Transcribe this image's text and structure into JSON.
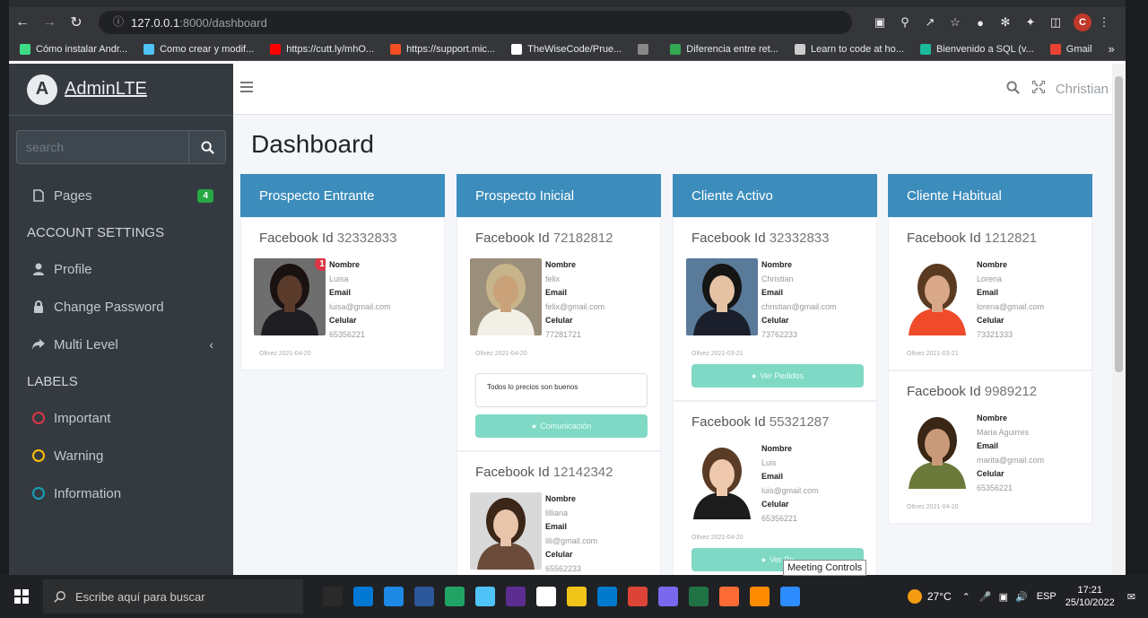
{
  "browser": {
    "url_host": "127.0.0.1",
    "url_path": ":8000/dashboard",
    "profile_initial": "C",
    "bookmarks": [
      {
        "label": "Cómo instalar Andr...",
        "color": "#3ddc84"
      },
      {
        "label": "Como crear y modif...",
        "color": "#4fc3f7"
      },
      {
        "label": "https://cutt.ly/mhO...",
        "color": "#ff0000"
      },
      {
        "label": "https://support.mic...",
        "color": "#f25022"
      },
      {
        "label": "TheWiseCode/Prue...",
        "color": "#ffffff"
      },
      {
        "label": "",
        "color": "#888888"
      },
      {
        "label": "Diferencia entre ret...",
        "color": "#34a853"
      },
      {
        "label": "Learn to code at ho...",
        "color": "#cccccc"
      },
      {
        "label": "Bienvenido a SQL (v...",
        "color": "#1abc9c"
      },
      {
        "label": "Gmail",
        "color": "#ea4335"
      }
    ]
  },
  "sidebar": {
    "brand_logo": "A",
    "brand": "AdminLTE",
    "search_placeholder": "search",
    "pages_label": "Pages",
    "pages_badge": "4",
    "account_header": "ACCOUNT SETTINGS",
    "profile_label": "Profile",
    "change_password_label": "Change Password",
    "multi_level_label": "Multi Level",
    "labels_header": "LABELS",
    "labels": [
      {
        "label": "Important",
        "color": "#dc3545"
      },
      {
        "label": "Warning",
        "color": "#ffc107"
      },
      {
        "label": "Information",
        "color": "#17a2b8"
      }
    ]
  },
  "topbar": {
    "user": "Christian"
  },
  "page": {
    "title": "Dashboard"
  },
  "field_labels": {
    "name": "Nombre",
    "email": "Email",
    "phone": "Celular",
    "fb": "Facebook Id"
  },
  "columns": [
    {
      "title": "Prospecto Entrante",
      "cards": [
        {
          "fb_id": "32332833",
          "nombre": "Luisa",
          "email": "luisa@gmail.com",
          "celular": "65356221",
          "date": "Oltvez 2021-04-20",
          "notif": "1",
          "photo": {
            "bg": "#6e6e6e",
            "skin": "#5a3a2a",
            "hair": "#1a1210",
            "cloth": "#1e1e22"
          }
        }
      ]
    },
    {
      "title": "Prospecto Inicial",
      "cards": [
        {
          "fb_id": "72182812",
          "nombre": "felix",
          "email": "felix@gmail.com",
          "celular": "77281721",
          "date": "Oltvez 2021-04-20",
          "note": "Todos lo precios son buenos",
          "button": "Comunicación",
          "photo": {
            "bg": "#9a8f7a",
            "skin": "#c9a27a",
            "hair": "#c8b48a",
            "cloth": "#f2efe6"
          }
        },
        {
          "fb_id": "12142342",
          "nombre": "lilliana",
          "email": "lili@gmail.com",
          "celular": "65562233",
          "photo": {
            "bg": "#d9d9d9",
            "skin": "#e8c4aa",
            "hair": "#3b2618",
            "cloth": "#6b4c3b"
          }
        }
      ]
    },
    {
      "title": "Cliente Activo",
      "cards": [
        {
          "fb_id": "32332833",
          "nombre": "Christian",
          "email": "christian@gmail.com",
          "celular": "73762233",
          "date": "Oltvez 2021-03-21",
          "button": "Ver Pedidos",
          "photo": {
            "bg": "#5a7a9a",
            "skin": "#e6c2a4",
            "hair": "#151515",
            "cloth": "#1b1f2b"
          }
        },
        {
          "fb_id": "55321287",
          "nombre": "Luis",
          "email": "luis@gmail.com",
          "celular": "65356221",
          "date": "Oltvez 2021-04-20",
          "button": "Ver Pe",
          "photo": {
            "bg": "#ffffff",
            "skin": "#efc9ae",
            "hair": "#5a3c26",
            "cloth": "#1c1c1c"
          }
        }
      ]
    },
    {
      "title": "Cliente Habitual",
      "cards": [
        {
          "fb_id": "1212821",
          "nombre": "Lorena",
          "email": "lorena@gmail.com",
          "celular": "73321333",
          "date": "Oltvez 2021-03-21",
          "photo": {
            "bg": "#ffffff",
            "skin": "#d9a888",
            "hair": "#5b3a22",
            "cloth": "#ef4a2a"
          }
        },
        {
          "fb_id": "9989212",
          "nombre": "Maria Aguirres",
          "email": "marita@gmail.com",
          "celular": "65356221",
          "date": "Oltvez 2021-04-20",
          "photo": {
            "bg": "#ffffff",
            "skin": "#c99a7a",
            "hair": "#3a2614",
            "cloth": "#6b7a3a"
          }
        }
      ]
    }
  ],
  "tooltip": "Meeting Controls",
  "taskbar": {
    "search_placeholder": "Escribe aquí para buscar",
    "weather": "27°C",
    "language": "ESP",
    "time": "17:21",
    "date": "25/10/2022",
    "apps": [
      "#2a2a2a",
      "#0078d4",
      "#1e88e5",
      "#2b579a",
      "#21a366",
      "#4fc3f7",
      "#5c2d91",
      "#ffffff",
      "#f0c419",
      "#007acc",
      "#db4437",
      "#7b68ee",
      "#217346",
      "#ff6b35",
      "#ff8c00",
      "#2d8cff"
    ]
  }
}
